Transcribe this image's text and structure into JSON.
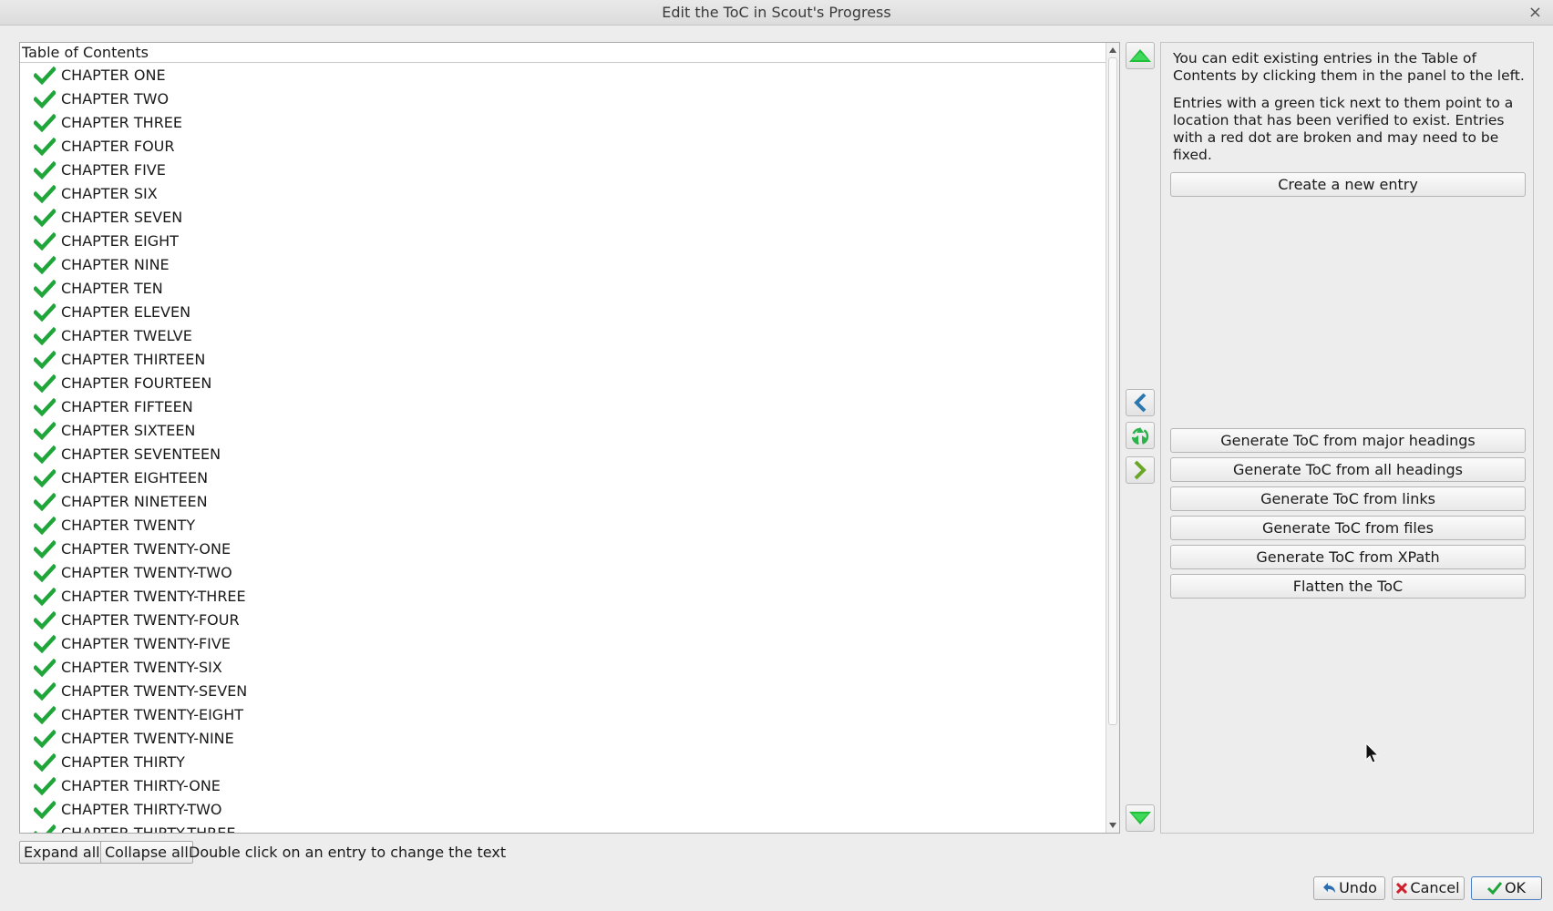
{
  "window": {
    "title": "Edit the ToC in Scout's Progress"
  },
  "toc": {
    "header": "Table of Contents",
    "items": [
      "CHAPTER ONE",
      "CHAPTER TWO",
      "CHAPTER THREE",
      "CHAPTER FOUR",
      "CHAPTER FIVE",
      "CHAPTER SIX",
      "CHAPTER SEVEN",
      "CHAPTER EIGHT",
      "CHAPTER NINE",
      "CHAPTER TEN",
      "CHAPTER ELEVEN",
      "CHAPTER TWELVE",
      "CHAPTER THIRTEEN",
      "CHAPTER FOURTEEN",
      "CHAPTER FIFTEEN",
      "CHAPTER SIXTEEN",
      "CHAPTER SEVENTEEN",
      "CHAPTER EIGHTEEN",
      "CHAPTER NINETEEN",
      "CHAPTER TWENTY",
      "CHAPTER TWENTY-ONE",
      "CHAPTER TWENTY-TWO",
      "CHAPTER TWENTY-THREE",
      "CHAPTER TWENTY-FOUR",
      "CHAPTER TWENTY-FIVE",
      "CHAPTER TWENTY-SIX",
      "CHAPTER TWENTY-SEVEN",
      "CHAPTER TWENTY-EIGHT",
      "CHAPTER TWENTY-NINE",
      "CHAPTER THIRTY",
      "CHAPTER THIRTY-ONE",
      "CHAPTER THIRTY-TWO",
      "CHAPTER THIRTY-THREE"
    ],
    "status_icon": "green-tick-icon"
  },
  "info": {
    "p1": "You can edit existing entries in the Table of Contents by clicking them in the panel to the left.",
    "p2": "Entries with a green tick next to them point to a location that has been verified to exist. Entries with a red dot are broken and may need to be fixed."
  },
  "buttons": {
    "create_entry": "Create a new entry",
    "gen_major": "Generate ToC from major headings",
    "gen_all": "Generate ToC from all headings",
    "gen_links": "Generate ToC from links",
    "gen_files": "Generate ToC from files",
    "gen_xpath": "Generate ToC from XPath",
    "flatten": "Flatten the ToC",
    "expand_all": "Expand all",
    "collapse_all": "Collapse all",
    "undo": "Undo",
    "cancel": "Cancel",
    "ok": "OK"
  },
  "hint": "Double click on an entry to change the text",
  "colors": {
    "tick": "#1fa53a",
    "arrow_green": "#1fbf3a",
    "arrow_blue": "#2a78b0",
    "cancel_red": "#d0202b"
  }
}
